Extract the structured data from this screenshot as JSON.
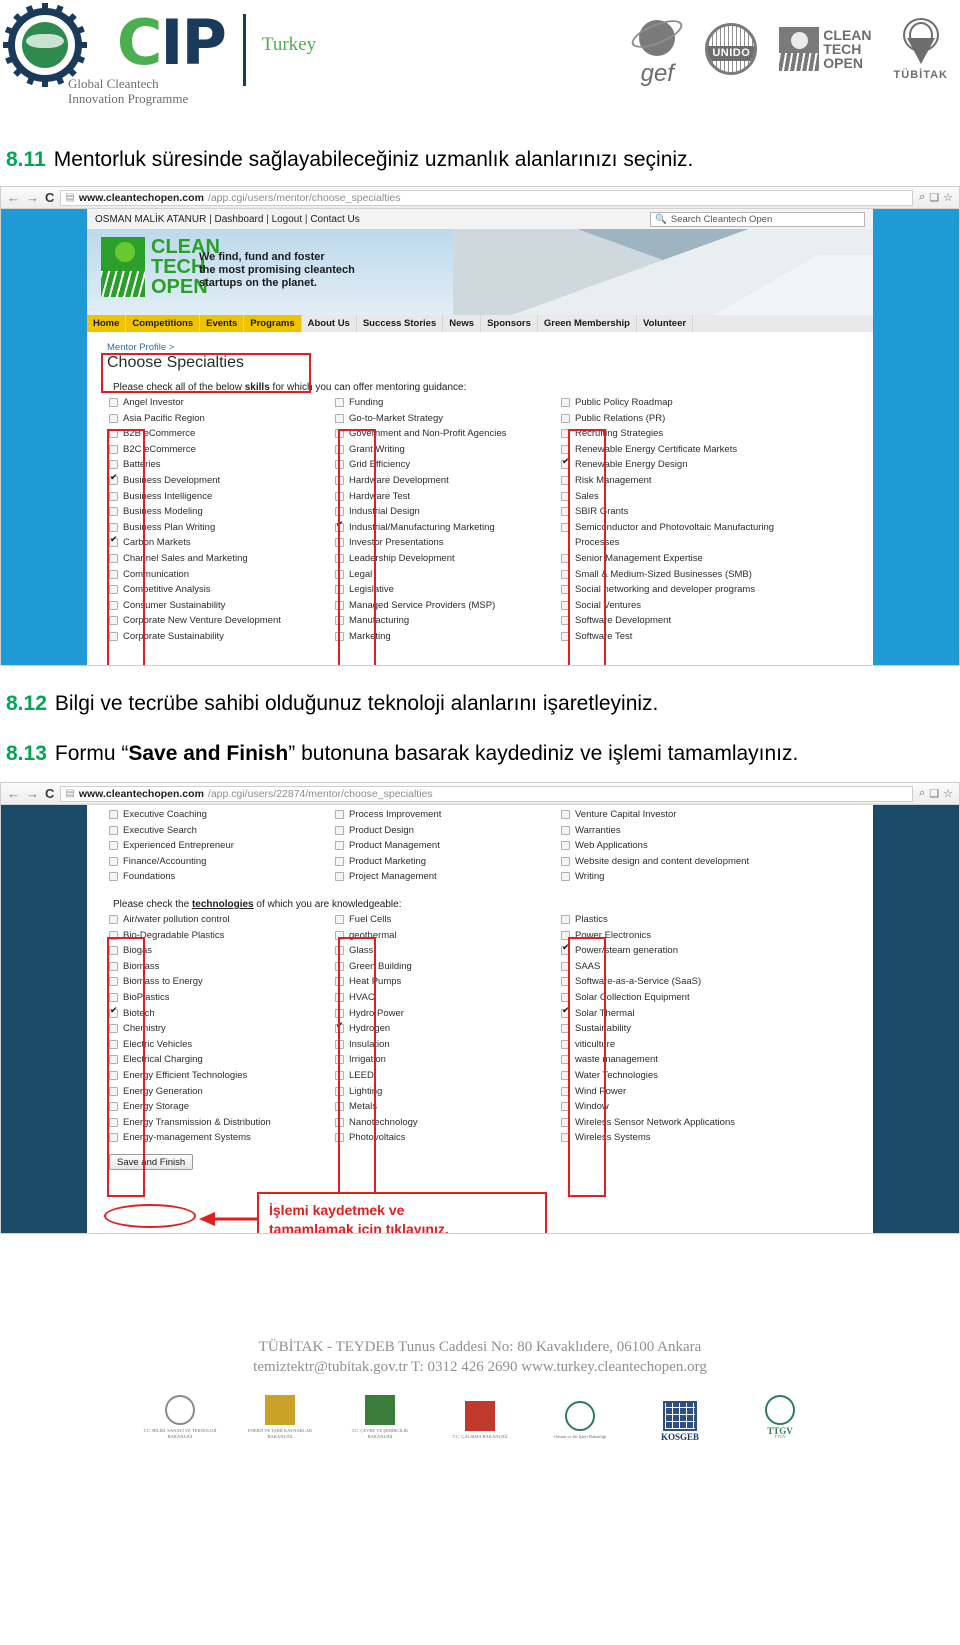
{
  "header": {
    "gcip": {
      "cip_g": "G",
      "cip_c": "C",
      "cip_rest": "IP",
      "sub_line1": "Global Cleantech",
      "sub_line2": "Innovation Programme",
      "country": "Turkey"
    },
    "partners": {
      "gef": "gef",
      "unido": "UNIDO",
      "cto_line1": "CLEAN",
      "cto_line2": "TECH",
      "cto_line3": "OPEN",
      "tubitak": "TÜBİTAK"
    }
  },
  "steps": {
    "s811_num": "8.11",
    "s811_text": "Mentorluk süresinde sağlayabileceğiniz uzmanlık alanlarınızı seçiniz.",
    "s812_num": "8.12",
    "s812_text": "Bilgi ve tecrübe sahibi olduğunuz teknoloji alanlarını işaretleyiniz.",
    "s813_num": "8.13",
    "s813_pre": "Formu “",
    "s813_bold": "Save and Finish",
    "s813_post": "” butonuna basarak kaydediniz ve işlemi tamamlayınız."
  },
  "shot1": {
    "browser": {
      "back_icon": "←",
      "forward_icon": "→",
      "reload_icon": "C",
      "doc_icon": "page-icon",
      "url_host": "www.cleantechopen.com",
      "url_path": "/app.cgi/users/mentor/choose_specialties",
      "zoom_icon": "⌕",
      "copy_icon": "❏",
      "star_icon": "☆"
    },
    "site": {
      "user_name": "OSMAN MALİK ATANUR",
      "link_dashboard": "Dashboard",
      "link_logout": "Logout",
      "link_contact": "Contact Us",
      "search_icon": "search-icon",
      "search_placeholder": "Search Cleantech Open",
      "logo_line1": "CLEAN",
      "logo_line2": "TECH",
      "logo_line3": "OPEN",
      "tagline_1": "We find, fund and foster",
      "tagline_2": "the most promising cleantech",
      "tagline_3": "startups on the planet.",
      "nav": [
        {
          "label": "Home",
          "highlight": true
        },
        {
          "label": "Competitions",
          "highlight": true
        },
        {
          "label": "Events",
          "highlight": true
        },
        {
          "label": "Programs",
          "highlight": true
        },
        {
          "label": "About Us",
          "highlight": false
        },
        {
          "label": "Success Stories",
          "highlight": false
        },
        {
          "label": "News",
          "highlight": false
        },
        {
          "label": "Sponsors",
          "highlight": false
        },
        {
          "label": "Green Membership",
          "highlight": false
        },
        {
          "label": "Volunteer",
          "highlight": false
        }
      ]
    },
    "breadcrumb": "Mentor Profile >",
    "page_title": "Choose Specialties",
    "instruction_pre": "Please check all of the below ",
    "instruction_bold": "skills",
    "instruction_post": " for which you can offer mentoring guidance:",
    "col1": [
      {
        "label": "Angel Investor",
        "checked": false
      },
      {
        "label": "Asia Pacific Region",
        "checked": false
      },
      {
        "label": "B2B eCommerce",
        "checked": false
      },
      {
        "label": "B2C eCommerce",
        "checked": false
      },
      {
        "label": "Batteries",
        "checked": false
      },
      {
        "label": "Business Development",
        "checked": true
      },
      {
        "label": "Business Intelligence",
        "checked": false
      },
      {
        "label": "Business Modeling",
        "checked": false
      },
      {
        "label": "Business Plan Writing",
        "checked": false
      },
      {
        "label": "Carbon Markets",
        "checked": true
      },
      {
        "label": "Channel Sales and Marketing",
        "checked": false
      },
      {
        "label": "Communication",
        "checked": false
      },
      {
        "label": "Competitive Analysis",
        "checked": false
      },
      {
        "label": "Consumer Sustainability",
        "checked": false
      },
      {
        "label": "Corporate New Venture Development",
        "checked": false
      },
      {
        "label": "Corporate Sustainability",
        "checked": false
      }
    ],
    "col2": [
      {
        "label": "Funding",
        "checked": false
      },
      {
        "label": "Go-to-Market Strategy",
        "checked": false
      },
      {
        "label": "Government and Non-Profit Agencies",
        "checked": false
      },
      {
        "label": "Grant Writing",
        "checked": false
      },
      {
        "label": "Grid Efficiency",
        "checked": false
      },
      {
        "label": "Hardware Development",
        "checked": false
      },
      {
        "label": "Hardware Test",
        "checked": false
      },
      {
        "label": "Industrial Design",
        "checked": false
      },
      {
        "label": "Industrial/Manufacturing Marketing",
        "checked": true
      },
      {
        "label": "Investor Presentations",
        "checked": false
      },
      {
        "label": "Leadership Development",
        "checked": false
      },
      {
        "label": "Legal",
        "checked": false
      },
      {
        "label": "Legislative",
        "checked": false
      },
      {
        "label": "Managed Service Providers (MSP)",
        "checked": false
      },
      {
        "label": "Manufacturing",
        "checked": false
      },
      {
        "label": "Marketing",
        "checked": false
      }
    ],
    "col3": [
      {
        "label": "Public Policy Roadmap",
        "checked": false
      },
      {
        "label": "Public Relations (PR)",
        "checked": false
      },
      {
        "label": "Recruiting Strategies",
        "checked": false
      },
      {
        "label": "Renewable Energy Certificate Markets",
        "checked": false
      },
      {
        "label": "Renewable Energy Design",
        "checked": true
      },
      {
        "label": "Risk Management",
        "checked": false
      },
      {
        "label": "Sales",
        "checked": false
      },
      {
        "label": "SBIR Grants",
        "checked": false
      },
      {
        "label": "Semiconductor and Photovoltaic Manufacturing Processes",
        "checked": false
      },
      {
        "label": "Senior Management Expertise",
        "checked": false
      },
      {
        "label": "Small & Medium-Sized Businesses (SMB)",
        "checked": false
      },
      {
        "label": "Social networking and developer programs",
        "checked": false
      },
      {
        "label": "Social Ventures",
        "checked": false
      },
      {
        "label": "Software Development",
        "checked": false
      },
      {
        "label": "Software Test",
        "checked": false
      }
    ]
  },
  "shot2": {
    "browser": {
      "back_icon": "←",
      "forward_icon": "→",
      "reload_icon": "C",
      "url_host": "www.cleantechopen.com",
      "url_path": "/app.cgi/users/22874/mentor/choose_specialties",
      "zoom_icon": "⌕",
      "copy_icon": "❏",
      "star_icon": "☆"
    },
    "skills_tail_col1": [
      {
        "label": "Executive Coaching",
        "checked": false
      },
      {
        "label": "Executive Search",
        "checked": false
      },
      {
        "label": "Experienced Entrepreneur",
        "checked": false
      },
      {
        "label": "Finance/Accounting",
        "checked": false
      },
      {
        "label": "Foundations",
        "checked": false
      }
    ],
    "skills_tail_col2": [
      {
        "label": "Process Improvement",
        "checked": false
      },
      {
        "label": "Product Design",
        "checked": false
      },
      {
        "label": "Product Management",
        "checked": false
      },
      {
        "label": "Product Marketing",
        "checked": false
      },
      {
        "label": "Project Management",
        "checked": false
      }
    ],
    "skills_tail_col3": [
      {
        "label": "Venture Capital Investor",
        "checked": false
      },
      {
        "label": "Warranties",
        "checked": false
      },
      {
        "label": "Web Applications",
        "checked": false
      },
      {
        "label": "Website design and content development",
        "checked": false
      },
      {
        "label": "Writing",
        "checked": false
      }
    ],
    "tech_instruction_pre": "Please check the ",
    "tech_instruction_bold": "technologies",
    "tech_instruction_post": " of which you are knowledgeable:",
    "tech_col1": [
      {
        "label": "Air/water pollution control",
        "checked": false
      },
      {
        "label": "Bio-Degradable Plastics",
        "checked": false
      },
      {
        "label": "Biogas",
        "checked": false
      },
      {
        "label": "Biomass",
        "checked": false
      },
      {
        "label": "Biomass to Energy",
        "checked": false
      },
      {
        "label": "BioPlastics",
        "checked": false
      },
      {
        "label": "Biotech",
        "checked": true
      },
      {
        "label": "Chemistry",
        "checked": false
      },
      {
        "label": "Electric Vehicles",
        "checked": false
      },
      {
        "label": "Electrical Charging",
        "checked": false
      },
      {
        "label": "Energy Efficient Technologies",
        "checked": false
      },
      {
        "label": "Energy Generation",
        "checked": false
      },
      {
        "label": "Energy Storage",
        "checked": false
      },
      {
        "label": "Energy Transmission & Distribution",
        "checked": false
      },
      {
        "label": "Energy-management Systems",
        "checked": false
      }
    ],
    "tech_col2": [
      {
        "label": "Fuel Cells",
        "checked": false
      },
      {
        "label": "geothermal",
        "checked": false
      },
      {
        "label": "Glass",
        "checked": false
      },
      {
        "label": "Green Building",
        "checked": false
      },
      {
        "label": "Heat Pumps",
        "checked": false
      },
      {
        "label": "HVAC",
        "checked": false
      },
      {
        "label": "Hydro Power",
        "checked": false
      },
      {
        "label": "Hydrogen",
        "checked": true
      },
      {
        "label": "Insulation",
        "checked": false
      },
      {
        "label": "Irrigation",
        "checked": false
      },
      {
        "label": "LEED",
        "checked": false
      },
      {
        "label": "Lighting",
        "checked": false
      },
      {
        "label": "Metals",
        "checked": false
      },
      {
        "label": "Nanotechnology",
        "checked": false
      },
      {
        "label": "Photovoltaics",
        "checked": false
      }
    ],
    "tech_col3": [
      {
        "label": "Plastics",
        "checked": false
      },
      {
        "label": "Power Electronics",
        "checked": false
      },
      {
        "label": "Power/steam generation",
        "checked": true
      },
      {
        "label": "SAAS",
        "checked": false
      },
      {
        "label": "Software-as-a-Service (SaaS)",
        "checked": false
      },
      {
        "label": "Solar Collection Equipment",
        "checked": false
      },
      {
        "label": "Solar Thermal",
        "checked": true
      },
      {
        "label": "Sustainability",
        "checked": false
      },
      {
        "label": "viticulture",
        "checked": false
      },
      {
        "label": "waste management",
        "checked": false
      },
      {
        "label": "Water Technologies",
        "checked": false
      },
      {
        "label": "Wind Power",
        "checked": false
      },
      {
        "label": "Window",
        "checked": false
      },
      {
        "label": "Wireless Sensor Network Applications",
        "checked": false
      },
      {
        "label": "Wireless Systems",
        "checked": false
      }
    ],
    "save_button": "Save and Finish",
    "callout_line1": "İşlemi kaydetmek ve",
    "callout_line2": "tamamlamak için tıklayınız."
  },
  "footer": {
    "line1": "TÜBİTAK - TEYDEB Tunus Caddesi No: 80 Kavaklıdere, 06100 Ankara",
    "line2_mail": "temiztektr@tubitak.gov.tr",
    "line2_tel": "T:  0312 426 2690",
    "line2_web": "www.turkey.cleantechopen.org",
    "logos": [
      {
        "name": "T.C. BİLİM, SANAYİ VE TEKNOLOJİ BAKANLIĞI"
      },
      {
        "name": "ENERJİ VE TABİİ KAYNAKLAR BAKANLIĞI"
      },
      {
        "name": "T.C. ÇEVRE VE ŞEHİRCİLİK BAKANLIĞI"
      },
      {
        "name": "T.C. ÇALIŞMA BAKANLIĞI"
      },
      {
        "name": "Orman ve Su İşleri Bakanlığı"
      },
      {
        "name": "KOSGEB"
      },
      {
        "name": "TTGV"
      }
    ],
    "kosgeb_label": "KOSGEB",
    "ttgv_label": "TTGV"
  },
  "colors": {
    "accent_green": "#00a651",
    "annotation_red": "#e02020",
    "page_blue": "#1f9ad6",
    "dark_navy": "#0f3953"
  }
}
